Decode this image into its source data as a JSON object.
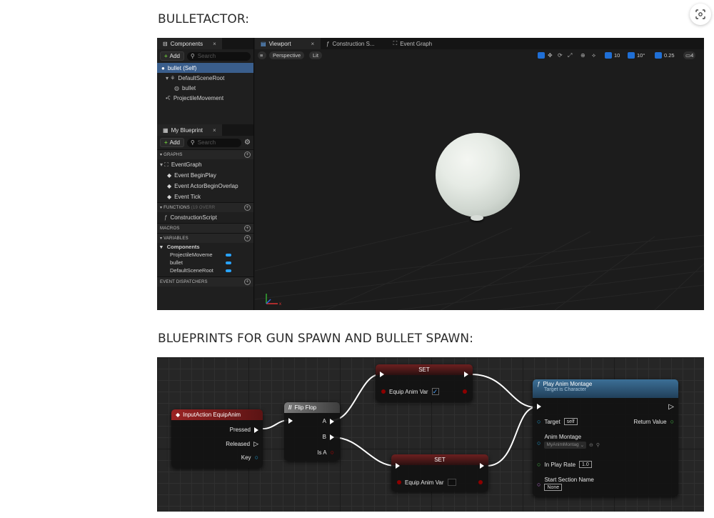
{
  "sections": {
    "title1": "BULLETACTOR:",
    "title2": "BLUEPRINTS FOR GUN SPAWN AND BULLET SPAWN:"
  },
  "editor": {
    "components_tab": "Components",
    "add_label": "Add",
    "search_placeholder": "Search",
    "components": [
      "bullet (Self)",
      "DefaultSceneRoot",
      "bullet",
      "ProjectileMovement"
    ],
    "my_blueprint_tab": "My Blueprint",
    "categories": {
      "graphs": "GRAPHS",
      "functions": "FUNCTIONS",
      "functions_note": "(19 OVERR",
      "macros": "MACROS",
      "variables": "VARIABLES",
      "event_dispatchers": "EVENT DISPATCHERS"
    },
    "graph_items": [
      "EventGraph",
      "Event BeginPlay",
      "Event ActorBeginOverlap",
      "Event Tick"
    ],
    "function_items": [
      "ConstructionScript"
    ],
    "variables_group": "Components",
    "variable_items": [
      "ProjectileMoveme",
      "bullet",
      "DefaultSceneRoot"
    ],
    "viewport_tabs": [
      "Viewport",
      "Construction S...",
      "Event Graph"
    ],
    "view_mode": "Perspective",
    "lighting_mode": "Lit",
    "toolbar_values": {
      "grid_snap": "10",
      "rotation_snap": "10°",
      "scale_snap": "0.25",
      "camera_speed": "4"
    },
    "axis_labels": {
      "x": "x"
    },
    "colors": {
      "selection": "#3a5e8c",
      "accent_blue": "#1f6fd6",
      "variable_pill": "#29a3ff"
    }
  },
  "blueprint": {
    "nodes": {
      "input_action": {
        "title": "InputAction EquipAnim",
        "pins": [
          "Pressed",
          "Released",
          "Key"
        ]
      },
      "flip_flop": {
        "title": "Flip Flop",
        "pins_out": [
          "A",
          "B",
          "Is A"
        ]
      },
      "set_top": {
        "title": "SET",
        "var": "Equip Anim Var",
        "checked": true
      },
      "set_bottom": {
        "title": "SET",
        "var": "Equip Anim Var",
        "checked": false
      },
      "play_montage": {
        "title": "Play Anim Montage",
        "subtitle": "Target is Character",
        "target_label": "Target",
        "target_value": "self",
        "return_label": "Return Value",
        "montage_label": "Anim Montage",
        "montage_value": "MyAnimMontag",
        "rate_label": "In Play Rate",
        "rate_value": "1.0",
        "section_label": "Start Section Name",
        "section_value": "None"
      }
    },
    "colors": {
      "input_header": "#7a1a1a",
      "flipflop_header": "#6d6d6d",
      "set_header": "#5a1f1f",
      "function_header": "#2d5a7a",
      "bool_pin": "#8c0000",
      "object_pin": "#1fa7e0",
      "float_pin": "#48c148",
      "name_pin": "#c675e0"
    }
  }
}
